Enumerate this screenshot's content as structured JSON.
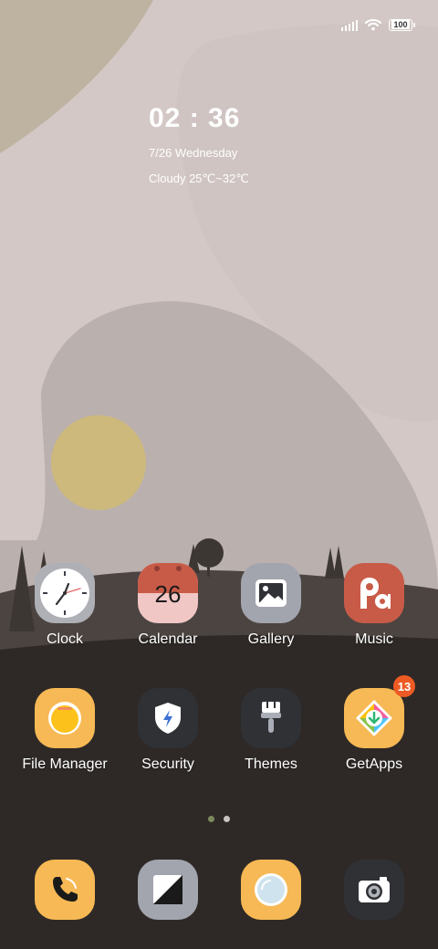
{
  "status_bar": {
    "battery": "100",
    "icons": [
      "signal-icon",
      "wifi-icon",
      "battery-icon"
    ]
  },
  "widget": {
    "time": "02 : 36",
    "date": "7/26 Wednesday",
    "weather": "Cloudy 25℃~32℃"
  },
  "apps": [
    {
      "label": "Clock",
      "icon": "clock-icon",
      "color": "#aeb0b6"
    },
    {
      "label": "Calendar",
      "day": "26",
      "icon": "calendar-icon",
      "color": "#c85b48"
    },
    {
      "label": "Gallery",
      "icon": "image-icon",
      "color": "#a2a5ad"
    },
    {
      "label": "Music",
      "icon": "music-icon",
      "color": "#c85b48"
    },
    {
      "label": "File Manager",
      "icon": "folder-icon",
      "color": "#f7b955"
    },
    {
      "label": "Security",
      "icon": "shield-icon",
      "color": "#2f3135"
    },
    {
      "label": "Themes",
      "icon": "brush-icon",
      "color": "#2f3135"
    },
    {
      "label": "GetApps",
      "icon": "download-icon",
      "color": "#f7b955",
      "badge": "13"
    }
  ],
  "page_indicator": {
    "pages": 2,
    "current": 1
  },
  "dock": [
    {
      "icon": "phone-icon"
    },
    {
      "icon": "messages-icon"
    },
    {
      "icon": "browser-icon"
    },
    {
      "icon": "camera-icon"
    }
  ],
  "colors": {
    "accent_yellow": "#f7b955",
    "accent_red": "#c85b48",
    "badge": "#ee5a24",
    "dark": "#2f3135"
  }
}
